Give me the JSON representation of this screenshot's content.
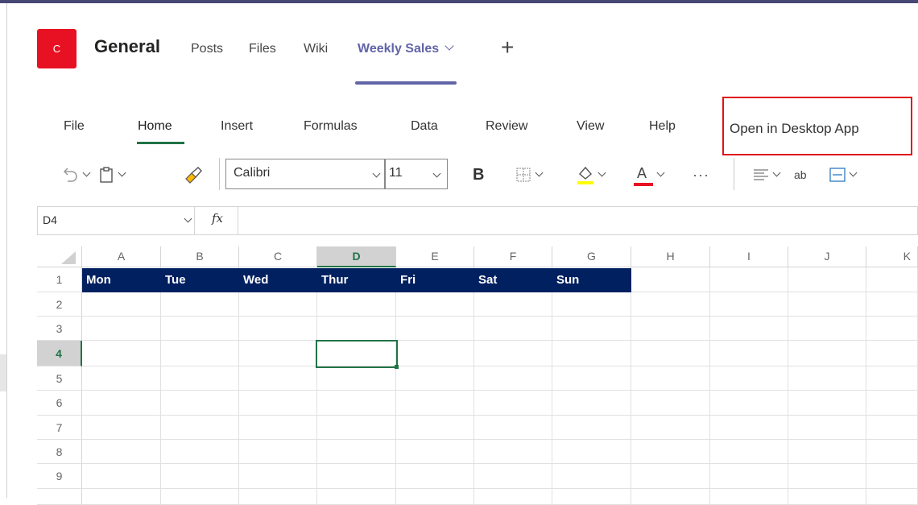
{
  "channel": {
    "avatar_letter": "C",
    "name": "General",
    "tabs": [
      {
        "label": "Posts"
      },
      {
        "label": "Files"
      },
      {
        "label": "Wiki"
      },
      {
        "label": "Weekly Sales",
        "active": true
      }
    ],
    "add_tab": "+"
  },
  "ribbon": {
    "menus": [
      "File",
      "Home",
      "Insert",
      "Formulas",
      "Data",
      "Review",
      "View",
      "Help"
    ],
    "active_menu": "Home",
    "open_desktop": "Open in Desktop App"
  },
  "toolbar": {
    "font_name": "Calibri",
    "font_size": "11",
    "bold": "B",
    "more": "···",
    "wrap_text_glyph": "ab",
    "font_color_letter": "A",
    "highlight_color": "#ffff00",
    "font_color": "#e81123"
  },
  "formula_bar": {
    "name_box": "D4",
    "fx": "fx",
    "value": ""
  },
  "sheet": {
    "columns": [
      "A",
      "B",
      "C",
      "D",
      "E",
      "F",
      "G",
      "H",
      "I",
      "J",
      "K"
    ],
    "selected_column": "D",
    "rows": [
      "1",
      "2",
      "3",
      "4",
      "5",
      "6",
      "7",
      "8",
      "9"
    ],
    "selected_row": "4",
    "selected_cell": "D4",
    "header_row": [
      "Mon",
      "Tue",
      "Wed",
      "Thur",
      "Fri",
      "Sat",
      "Sun"
    ],
    "header_fill": "#002060",
    "accent": "#217346"
  }
}
